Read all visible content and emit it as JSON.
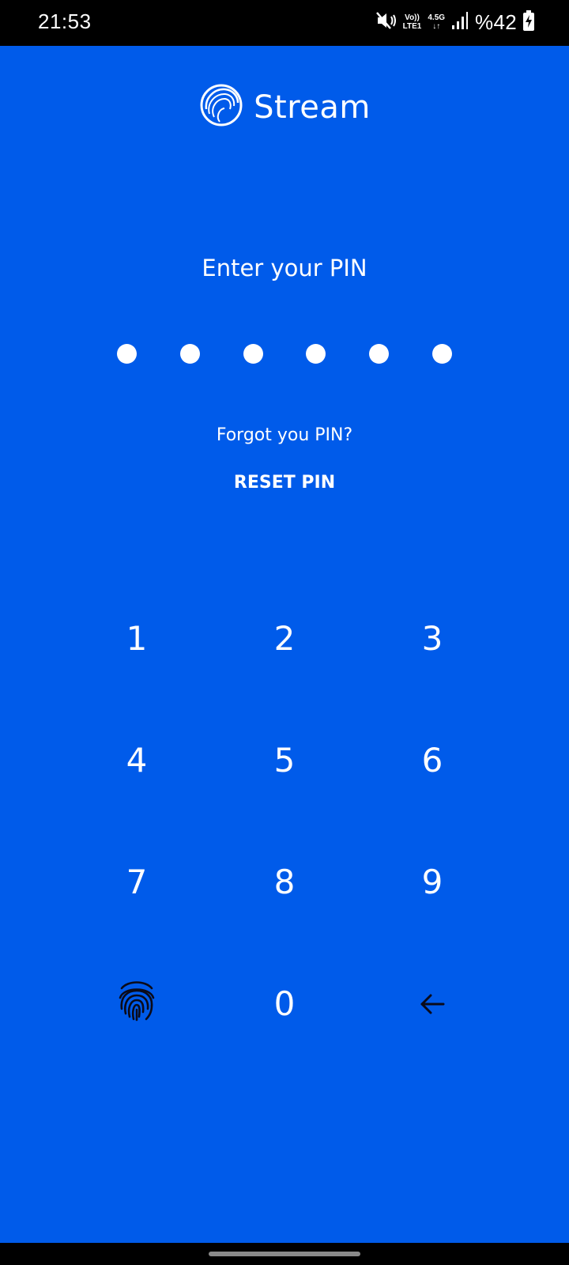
{
  "status_bar": {
    "time": "21:53",
    "network_top": "Vo))",
    "network_bottom": "LTE1",
    "network_gen": "4.5G",
    "battery": "%42",
    "icons": [
      "mute-vibrate-icon",
      "signal-icon",
      "battery-charging-icon"
    ]
  },
  "logo": {
    "name": "Stream",
    "icon": "stream-swirl-icon"
  },
  "pin": {
    "prompt": "Enter your PIN",
    "length": 6,
    "forgot_text": "Forgot you PIN?",
    "reset_label": "RESET PIN"
  },
  "keypad": {
    "keys": [
      "1",
      "2",
      "3",
      "4",
      "5",
      "6",
      "7",
      "8",
      "9"
    ],
    "zero": "0",
    "fingerprint_icon": "fingerprint-icon",
    "backspace_icon": "backspace-arrow-icon"
  },
  "colors": {
    "background": "#005BEA",
    "text": "#FFFFFF",
    "icon_dark": "#0B0B1A"
  }
}
